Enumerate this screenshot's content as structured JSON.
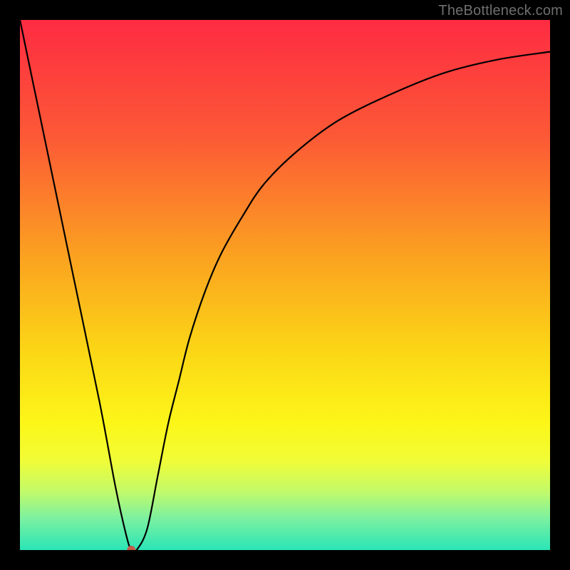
{
  "watermark": "TheBottleneck.com",
  "chart_data": {
    "type": "line",
    "title": "",
    "xlabel": "",
    "ylabel": "",
    "xlim": [
      0,
      100
    ],
    "ylim": [
      0,
      100
    ],
    "grid": false,
    "legend": false,
    "series": [
      {
        "name": "curve",
        "x": [
          0,
          5,
          10,
          15,
          18,
          20,
          21,
          22,
          24,
          26,
          28,
          30,
          32,
          35,
          38,
          42,
          46,
          52,
          60,
          70,
          80,
          90,
          100
        ],
        "y": [
          100,
          76,
          52,
          28,
          12,
          3,
          0,
          0,
          4,
          14,
          24,
          32,
          40,
          49,
          56,
          63,
          69,
          75,
          81,
          86,
          90,
          92.5,
          94
        ],
        "color": "#000000",
        "linewidth": 2
      }
    ],
    "marker": {
      "x": 21,
      "y": 0,
      "color": "#c45b4a",
      "radius": 6
    },
    "background_gradient": {
      "type": "vertical",
      "stops": [
        {
          "pct": 0,
          "color": "#fe2b42"
        },
        {
          "pct": 22,
          "color": "#fc5936"
        },
        {
          "pct": 45,
          "color": "#fba320"
        },
        {
          "pct": 62,
          "color": "#fbd516"
        },
        {
          "pct": 76,
          "color": "#fcf618"
        },
        {
          "pct": 83,
          "color": "#f1fc36"
        },
        {
          "pct": 89,
          "color": "#c2fa6a"
        },
        {
          "pct": 94,
          "color": "#7cf1a0"
        },
        {
          "pct": 100,
          "color": "#2ae5b7"
        }
      ]
    }
  }
}
